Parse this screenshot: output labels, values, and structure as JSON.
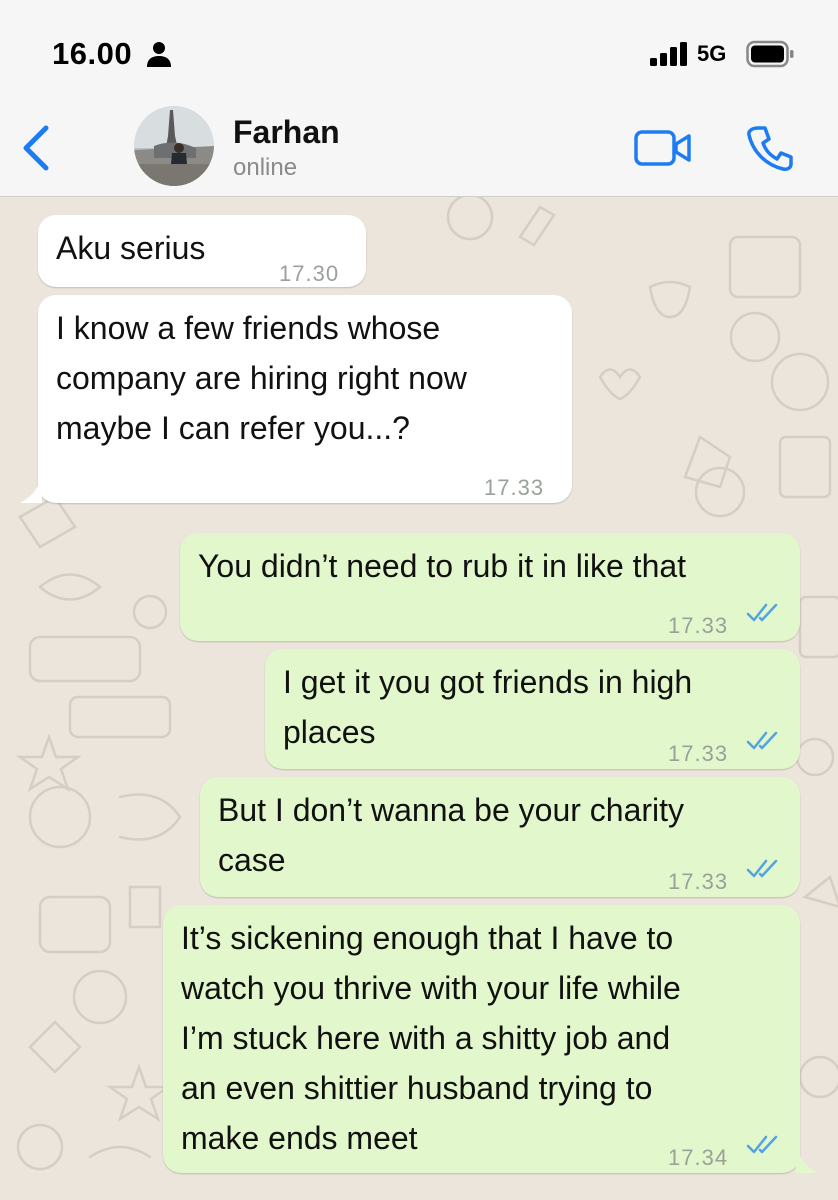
{
  "status_bar": {
    "time": "16.00",
    "network": "5G"
  },
  "header": {
    "contact_name": "Farhan",
    "contact_status": "online"
  },
  "messages": [
    {
      "direction": "incoming",
      "text": "Aku serius",
      "time": "17.30"
    },
    {
      "direction": "incoming",
      "text": "I know a few friends whose\ncompany are hiring right now\nmaybe I can refer you...?",
      "time": "17.33"
    },
    {
      "direction": "outgoing",
      "text": "You didn’t need to rub it in like that",
      "time": "17.33",
      "read": true
    },
    {
      "direction": "outgoing",
      "text": "I get it you got friends in high\nplaces",
      "time": "17.33",
      "read": true
    },
    {
      "direction": "outgoing",
      "text": "But I don’t wanna be your charity\ncase",
      "time": "17.33",
      "read": true
    },
    {
      "direction": "outgoing",
      "text": "It’s sickening enough that I have to\nwatch you thrive with your life while\nI’m stuck here with a shitty job and\nan even shittier husband trying to\nmake ends meet",
      "time": "17.34",
      "read": true
    }
  ],
  "icons": {
    "status": [
      "person-icon",
      "signal-icon",
      "battery-icon"
    ],
    "header": [
      "chevron-left-icon",
      "avatar",
      "video-call-icon",
      "phone-icon"
    ],
    "message": [
      "double-check-icon"
    ]
  },
  "colors": {
    "accent": "#1d7cf2",
    "incoming_bubble": "#ffffff",
    "outgoing_bubble": "#e2f7cb",
    "chat_background": "#ece5dc",
    "read_ticks": "#4fa3e6"
  }
}
